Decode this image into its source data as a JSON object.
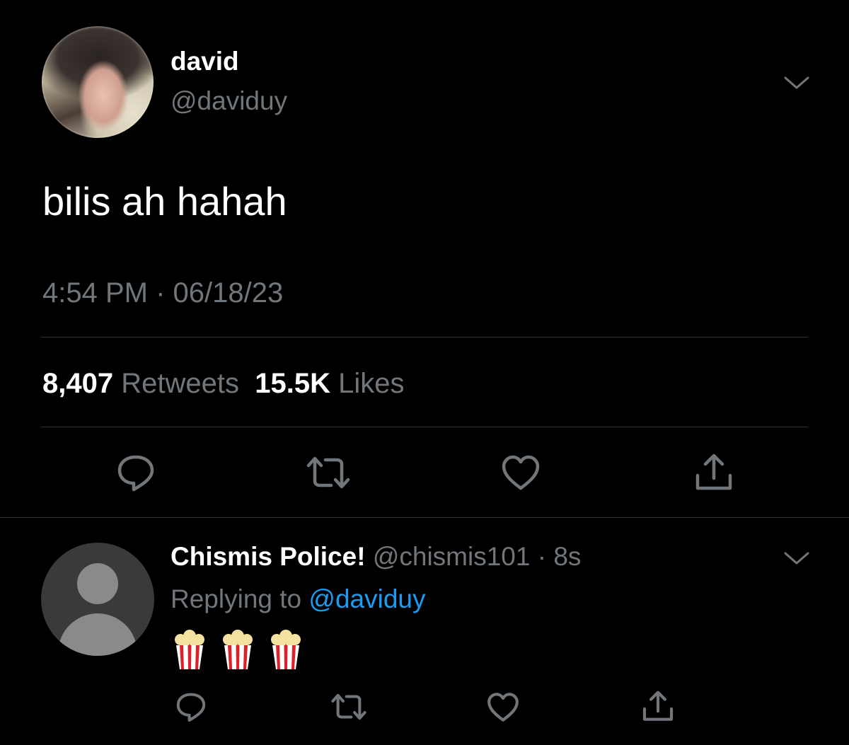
{
  "tweet": {
    "display_name": "david",
    "handle": "@daviduy",
    "text": "bilis ah hahah",
    "timestamp": "4:54 PM · 06/18/23",
    "retweets_count": "8,407",
    "retweets_label": "Retweets",
    "likes_count": "15.5K",
    "likes_label": "Likes",
    "actions": [
      "reply-icon",
      "retweet-icon",
      "like-icon",
      "share-icon"
    ]
  },
  "reply": {
    "display_name": "Chismis Police!",
    "handle_time": "@chismis101 · 8s",
    "replying_prefix": "Replying to",
    "replying_to": "@daviduy",
    "content_icons": [
      "popcorn-icon",
      "popcorn-icon",
      "popcorn-icon"
    ],
    "actions": [
      "reply-icon",
      "retweet-icon",
      "like-icon",
      "share-icon"
    ]
  },
  "colors": {
    "background": "#000000",
    "text": "#ffffff",
    "muted": "#71767b",
    "link": "#1d9bf0",
    "divider": "#2f3336"
  }
}
